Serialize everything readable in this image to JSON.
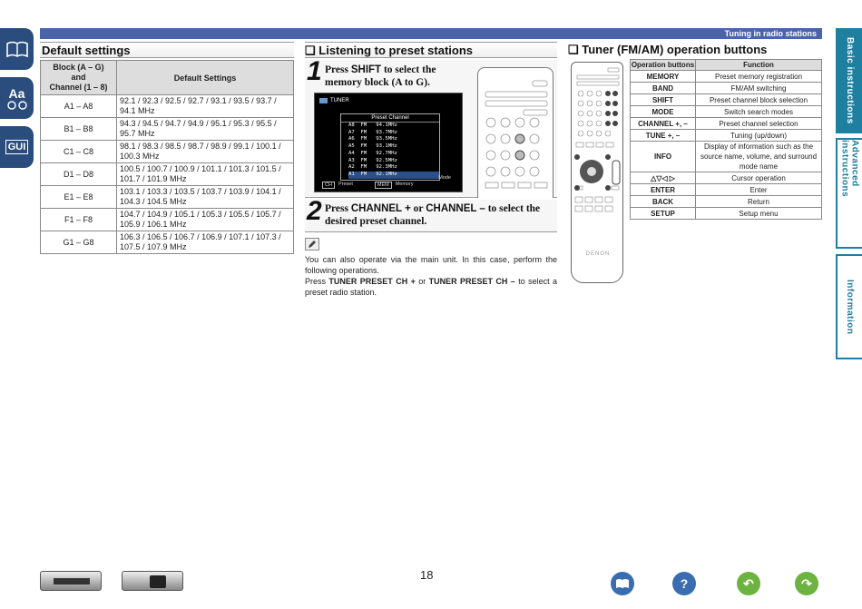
{
  "header": {
    "section_title": "Tuning in radio stations"
  },
  "left_icons": [
    {
      "label": "",
      "icon": "book-icon"
    },
    {
      "label": "Aa",
      "icon": "font-icon"
    },
    {
      "label": "GUI",
      "icon": "gui-icon"
    }
  ],
  "right_tabs": [
    "Basic instructions",
    "Advanced instructions",
    "Information"
  ],
  "default_settings": {
    "title": "Default settings",
    "col1_header": "Block (A – G)\nand\nChannel (1 – 8)",
    "col2_header": "Default Settings",
    "rows": [
      {
        "block": "A1 – A8",
        "settings": "92.1 / 92.3 / 92.5 / 92.7 / 93.1 / 93.5 / 93.7 / 94.1 MHz"
      },
      {
        "block": "B1 – B8",
        "settings": "94.3 / 94.5 / 94.7 / 94.9 / 95.1 / 95.3 / 95.5 / 95.7 MHz"
      },
      {
        "block": "C1 – C8",
        "settings": "98.1 / 98.3 / 98.5 / 98.7 / 98.9 / 99.1 / 100.1 / 100.3 MHz"
      },
      {
        "block": "D1 – D8",
        "settings": "100.5 / 100.7 / 100.9 / 101.1 / 101.3 / 101.5 / 101.7 / 101.9 MHz"
      },
      {
        "block": "E1 – E8",
        "settings": "103.1 / 103.3 / 103.5 / 103.7 / 103.9 / 104.1 / 104.3 / 104.5 MHz"
      },
      {
        "block": "F1 – F8",
        "settings": "104.7 / 104.9 / 105.1 / 105.3 / 105.5 / 105.7 / 105.9 / 106.1 MHz"
      },
      {
        "block": "G1 – G8",
        "settings": "106.3 / 106.5 / 106.7 / 106.9 / 107.1 / 107.3 / 107.5 / 107.9 MHz"
      }
    ]
  },
  "preset": {
    "title": "❑ Listening to preset stations",
    "step1_num": "1",
    "step1_pre": "Press ",
    "step1_key": "SHIFT",
    "step1_post": " to select the memory block (A to G).",
    "screen": {
      "tuner_label": "TUNER",
      "box_title": "Preset Channel",
      "channels": [
        "A8  FM   94.1MHz",
        "A7  FM   93.7MHz",
        "A6  FM   93.5MHz",
        "A5  FM   93.1MHz",
        "A4  FM   92.7MHz",
        "A3  FM   92.5MHz",
        "A2  FM   92.3MHz",
        "A1  FM   92.1MHz"
      ],
      "footer_left": "Preset",
      "footer_right": "Memory",
      "footer_mode": "Mode"
    },
    "step2_num": "2",
    "step2_pre": "Press ",
    "step2_key1": "CHANNEL +",
    "step2_mid": " or ",
    "step2_key2": "CHANNEL –",
    "step2_post": " to select the desired preset channel.",
    "note_line1": "You can also operate via the main unit. In this case, perform the following operations.",
    "note_line2_pre": "Press ",
    "note_line2_key1": "TUNER PRESET CH +",
    "note_line2_mid": " or ",
    "note_line2_key2": "TUNER PRESET CH –",
    "note_line2_post": " to select a preset radio station."
  },
  "remote": {
    "brand": "DENON"
  },
  "tuner_buttons": {
    "title": "❑ Tuner (FM/AM) operation buttons",
    "col1": "Operation buttons",
    "col2": "Function",
    "rows": [
      {
        "button": "MEMORY",
        "function": "Preset memory registration"
      },
      {
        "button": "BAND",
        "function": "FM/AM switching"
      },
      {
        "button": "SHIFT",
        "function": "Preset channel block selection"
      },
      {
        "button": "MODE",
        "function": "Switch search modes"
      },
      {
        "button": "CHANNEL +, –",
        "function": "Preset channel selection"
      },
      {
        "button": "TUNE +, –",
        "function": "Tuning (up/down)"
      },
      {
        "button": "INFO",
        "function": "Display of information such as the source name, volume, and surround mode name"
      },
      {
        "button": "△▽◁ ▷",
        "function": "Cursor operation"
      },
      {
        "button": "ENTER",
        "function": "Enter"
      },
      {
        "button": "BACK",
        "function": "Return"
      },
      {
        "button": "SETUP",
        "function": "Setup menu"
      }
    ]
  },
  "footer": {
    "page_number": "18",
    "nav_icons": [
      "book-icon",
      "help-icon",
      "back-icon",
      "forward-icon"
    ]
  }
}
